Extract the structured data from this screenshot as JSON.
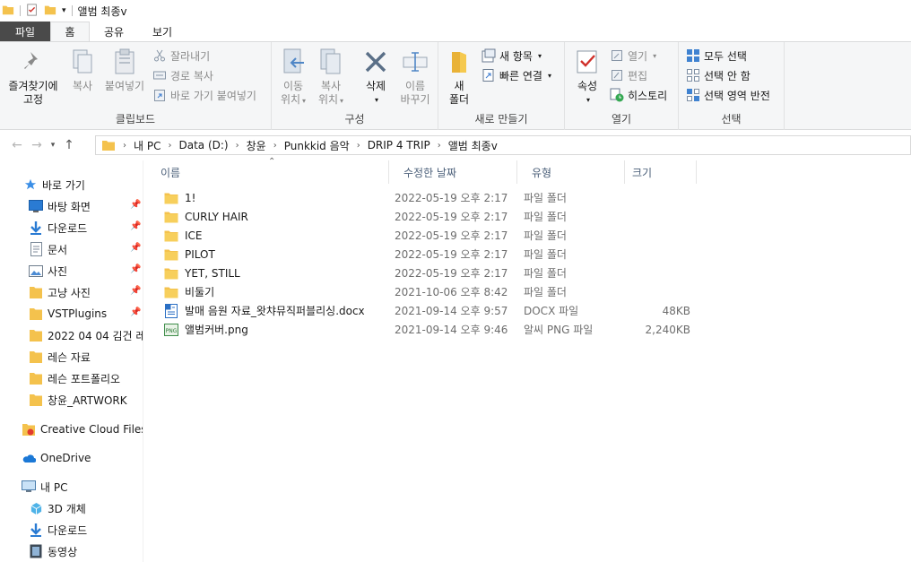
{
  "window": {
    "title": "앨범 최종v"
  },
  "tabs": [
    {
      "label": "파일"
    },
    {
      "label": "홈"
    },
    {
      "label": "공유"
    },
    {
      "label": "보기"
    }
  ],
  "ribbon": {
    "clipboard": {
      "pin_label_1": "즐겨찾기에",
      "pin_label_2": "고정",
      "copy_label": "복사",
      "paste_label": "붙여넣기",
      "cut_label": "잘라내기",
      "copy_path_label": "경로 복사",
      "paste_shortcut_label": "바로 가기 붙여넣기",
      "group_label": "클립보드"
    },
    "organize": {
      "move_label_1": "이동",
      "move_label_2": "위치",
      "copyto_label_1": "복사",
      "copyto_label_2": "위치",
      "delete_label": "삭제",
      "rename_label_1": "이름",
      "rename_label_2": "바꾸기",
      "group_label": "구성"
    },
    "new": {
      "newfolder_label_1": "새",
      "newfolder_label_2": "폴더",
      "newitem_label": "새 항목",
      "easyaccess_label": "빠른 연결",
      "group_label": "새로 만들기"
    },
    "open": {
      "properties_label": "속성",
      "open_label": "열기",
      "edit_label": "편집",
      "history_label": "히스토리",
      "group_label": "열기"
    },
    "select": {
      "selectall_label": "모두 선택",
      "selectnone_label": "선택 안 함",
      "invert_label": "선택 영역 반전",
      "group_label": "선택"
    }
  },
  "address": {
    "crumbs": [
      "내 PC",
      "Data (D:)",
      "창윤",
      "Punkkid 음악",
      "DRIP 4 TRIP",
      "앨범 최종v"
    ]
  },
  "navpane": {
    "quick_access": "바로 가기",
    "pinned": [
      {
        "label": "바탕 화면",
        "icon": "desktop-icon",
        "pinned": true
      },
      {
        "label": "다운로드",
        "icon": "download-icon",
        "pinned": true
      },
      {
        "label": "문서",
        "icon": "document-icon",
        "pinned": true
      },
      {
        "label": "사진",
        "icon": "pictures-icon",
        "pinned": true
      },
      {
        "label": "고냥 사진",
        "icon": "folder-icon",
        "pinned": true
      },
      {
        "label": "VSTPlugins",
        "icon": "folder-icon",
        "pinned": true
      },
      {
        "label": "2022 04 04 김건 레",
        "icon": "folder-icon",
        "pinned": false
      },
      {
        "label": "레슨 자료",
        "icon": "folder-icon",
        "pinned": false
      },
      {
        "label": "레슨 포트폴리오",
        "icon": "folder-icon",
        "pinned": false
      },
      {
        "label": "창윤_ARTWORK",
        "icon": "folder-icon",
        "pinned": false
      }
    ],
    "creative_cloud": "Creative Cloud Files",
    "onedrive": "OneDrive",
    "this_pc": "내 PC",
    "pc_items": [
      {
        "label": "3D 개체",
        "icon": "3d-objects-icon"
      },
      {
        "label": "다운로드",
        "icon": "download-icon"
      },
      {
        "label": "동영상",
        "icon": "video-icon"
      }
    ]
  },
  "columns": {
    "name": "이름",
    "date": "수정한 날짜",
    "type": "유형",
    "size": "크기"
  },
  "files": [
    {
      "name": "1!",
      "date": "2022-05-19 오후 2:17",
      "type": "파일 폴더",
      "size": "",
      "icon": "folder-icon"
    },
    {
      "name": "CURLY HAIR",
      "date": "2022-05-19 오후 2:17",
      "type": "파일 폴더",
      "size": "",
      "icon": "folder-icon"
    },
    {
      "name": "ICE",
      "date": "2022-05-19 오후 2:17",
      "type": "파일 폴더",
      "size": "",
      "icon": "folder-icon"
    },
    {
      "name": "PILOT",
      "date": "2022-05-19 오후 2:17",
      "type": "파일 폴더",
      "size": "",
      "icon": "folder-icon"
    },
    {
      "name": "YET, STILL",
      "date": "2022-05-19 오후 2:17",
      "type": "파일 폴더",
      "size": "",
      "icon": "folder-icon"
    },
    {
      "name": "비둘기",
      "date": "2021-10-06 오후 8:42",
      "type": "파일 폴더",
      "size": "",
      "icon": "folder-icon"
    },
    {
      "name": "발매 음원 자료_왓챠뮤직퍼블리싱.docx",
      "date": "2021-09-14 오후 9:57",
      "type": "DOCX 파일",
      "size": "48KB",
      "icon": "docx-icon"
    },
    {
      "name": "앨범커버.png",
      "date": "2021-09-14 오후 9:46",
      "type": "알씨 PNG 파일",
      "size": "2,240KB",
      "icon": "png-icon"
    }
  ],
  "colors": {
    "folder": "#f4c24d",
    "accent": "#1a73c7",
    "file_tab": "#4a4a4a"
  }
}
